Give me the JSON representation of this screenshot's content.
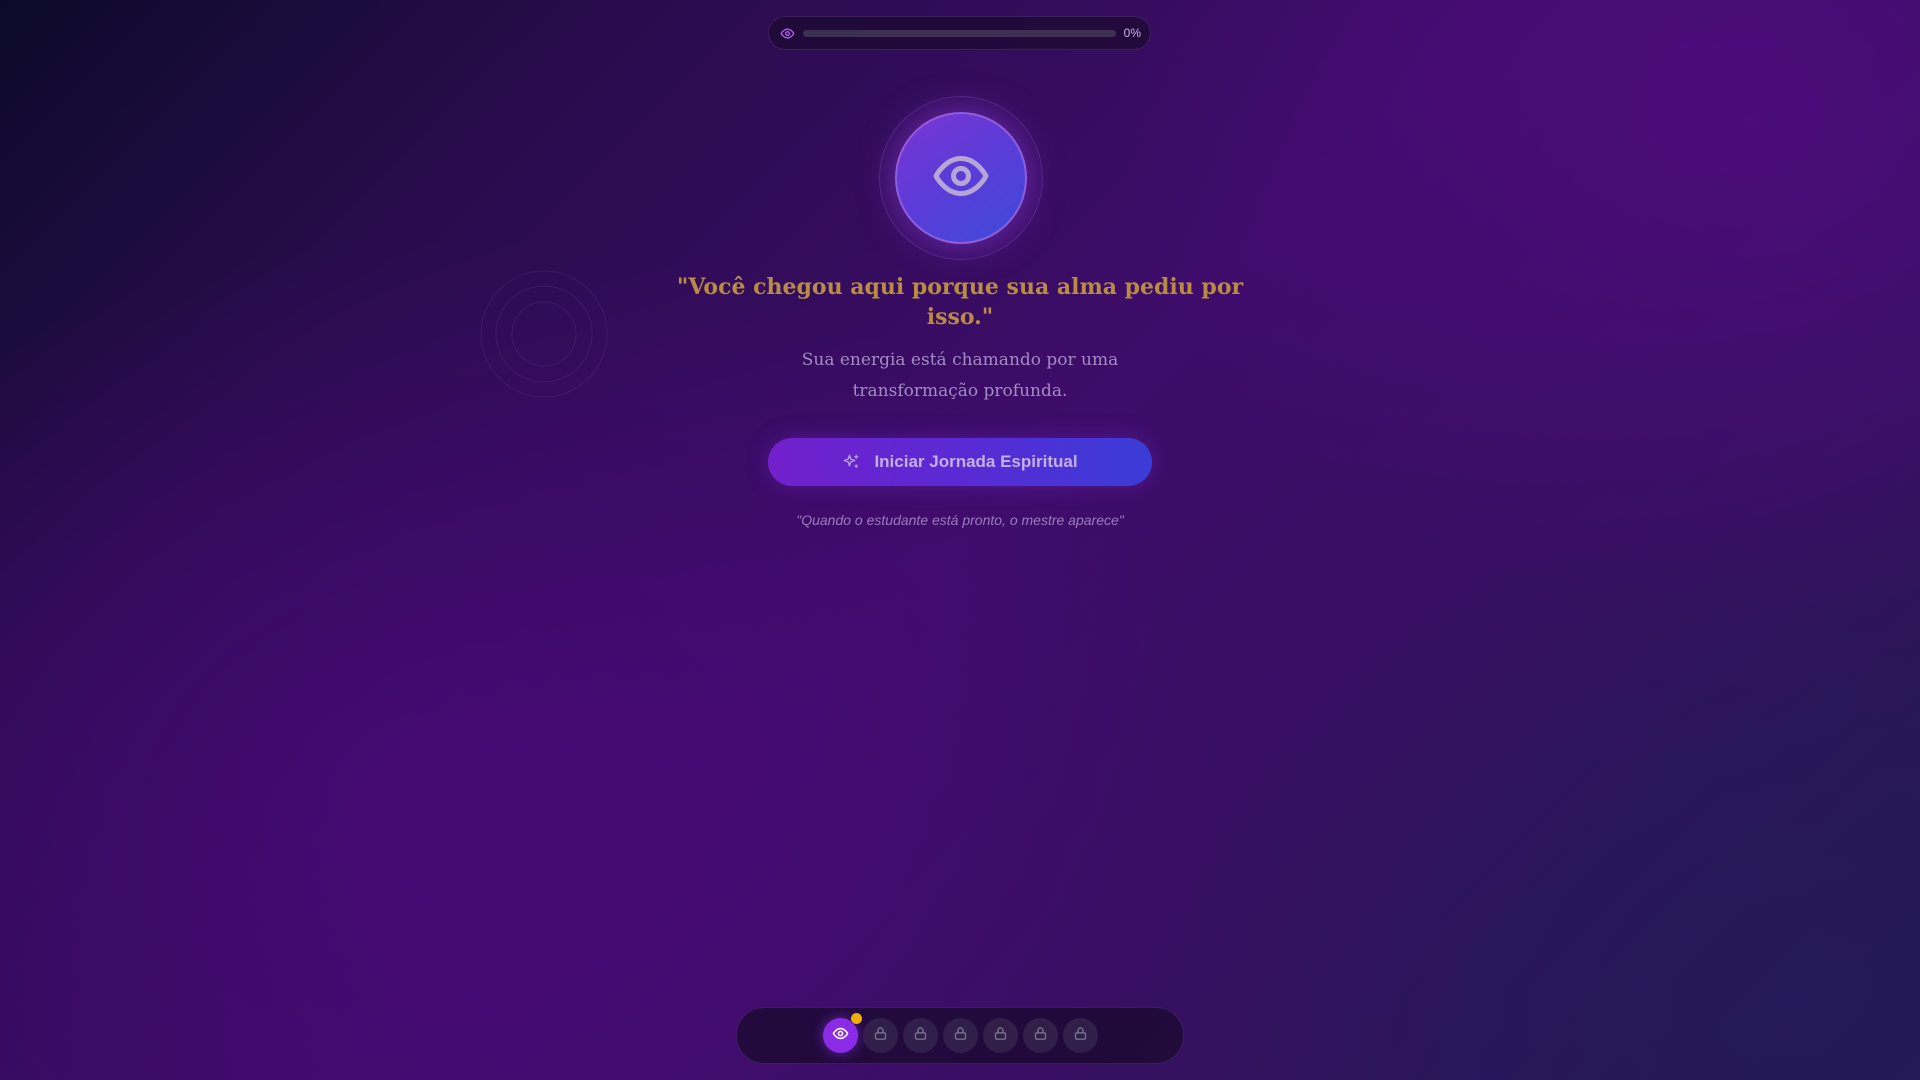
{
  "progress": {
    "icon": "eye-icon",
    "value_percent": 0,
    "label": "0%"
  },
  "hero": {
    "icon": "eye-icon",
    "headline": "\"Você chegou aqui porque sua alma pediu por isso.\"",
    "subtitle": "Sua energia está chamando por uma transformação profunda.",
    "button_icon": "sparkles-icon",
    "button_label": "Iniciar Jornada Espiritual",
    "footnote": "\"Quando o estudante está pronto, o mestre aparece\""
  },
  "steps": [
    {
      "icon": "eye-icon",
      "state": "active",
      "badge": true
    },
    {
      "icon": "lock-icon",
      "state": "locked"
    },
    {
      "icon": "lock-icon",
      "state": "locked"
    },
    {
      "icon": "lock-icon",
      "state": "locked"
    },
    {
      "icon": "lock-icon",
      "state": "locked"
    },
    {
      "icon": "lock-icon",
      "state": "locked"
    },
    {
      "icon": "lock-icon",
      "state": "locked"
    }
  ],
  "colors": {
    "headline": "#b88c42",
    "accent_purple": "#8a2be8",
    "accent_blue": "#3a3cd8",
    "badge": "#f0b000"
  }
}
